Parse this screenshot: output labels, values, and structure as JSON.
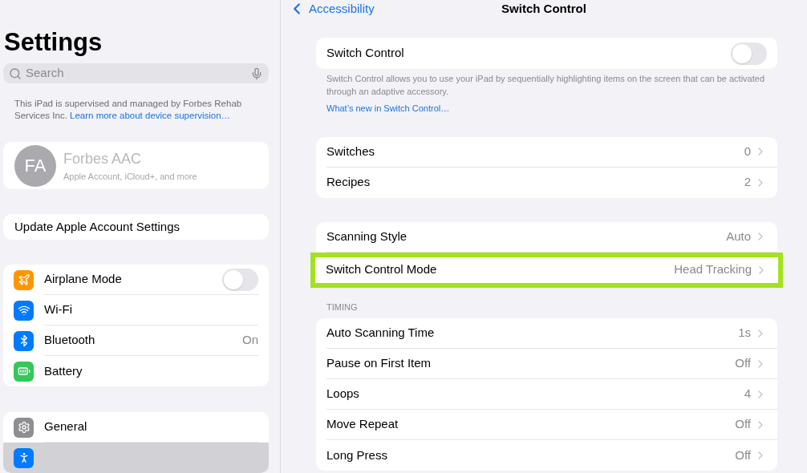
{
  "sidebar": {
    "title": "Settings",
    "search": {
      "placeholder": "Search"
    },
    "supervision": {
      "text": "This iPad is supervised and managed by Forbes Rehab Services Inc.",
      "link": "Learn more about device supervision…"
    },
    "account": {
      "initials": "FA",
      "name": "Forbes AAC",
      "subtitle": "Apple Account, iCloud+, and more"
    },
    "update_row": "Update Apple Account Settings",
    "groups": [
      [
        {
          "kind": "toggle",
          "label": "Airplane Mode",
          "on": false,
          "selected": false
        },
        {
          "kind": "link",
          "label": "Wi-Fi",
          "selected": false
        },
        {
          "kind": "link",
          "label": "Bluetooth",
          "value": "On",
          "selected": false
        },
        {
          "kind": "link",
          "label": "Battery",
          "selected": false
        }
      ],
      [
        {
          "kind": "link",
          "label": "General",
          "selected": false
        },
        {
          "kind": "link",
          "selected": true
        }
      ]
    ]
  },
  "detail": {
    "back": "Accessibility",
    "title": "Switch Control",
    "main_toggle": {
      "label": "Switch Control",
      "on": false
    },
    "footer": "Switch Control allows you to use your iPad by sequentially highlighting items on the screen that can be activated through an adaptive accessory.",
    "footer_link": "What’s new in Switch Control…",
    "sections": [
      {
        "rows": [
          {
            "label": "Switches",
            "value": "0",
            "highlighted": false
          },
          {
            "label": "Recipes",
            "value": "2",
            "highlighted": false
          }
        ]
      },
      {
        "rows": [
          {
            "label": "Scanning Style",
            "value": "Auto",
            "highlighted": false
          },
          {
            "label": "Switch Control Mode",
            "value": "Head Tracking",
            "highlighted": true
          }
        ]
      },
      {
        "header": "TIMING",
        "rows": [
          {
            "label": "Auto Scanning Time",
            "value": "1s",
            "highlighted": false
          },
          {
            "label": "Pause on First Item",
            "value": "Off",
            "highlighted": false
          },
          {
            "label": "Loops",
            "value": "4",
            "highlighted": false
          },
          {
            "label": "Move Repeat",
            "value": "Off",
            "highlighted": false
          },
          {
            "label": "Long Press",
            "value": "Off",
            "highlighted": false
          }
        ]
      }
    ]
  }
}
